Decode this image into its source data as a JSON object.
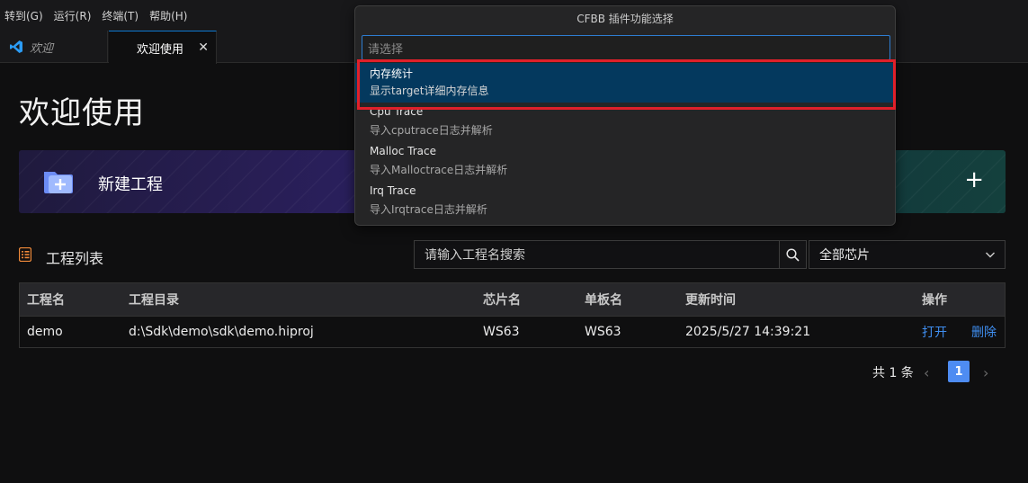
{
  "menubar": {
    "items": [
      "转到(G)",
      "运行(R)",
      "终端(T)",
      "帮助(H)"
    ]
  },
  "tabs": [
    {
      "label": "欢迎",
      "active": false
    },
    {
      "label": "欢迎使用",
      "active": true
    }
  ],
  "main": {
    "title": "欢迎使用",
    "new_project_label": "新建工程",
    "list_title": "工程列表",
    "search_placeholder": "请输入工程名搜索",
    "chip_filter": "全部芯片"
  },
  "table": {
    "headers": [
      "工程名",
      "工程目录",
      "芯片名",
      "单板名",
      "更新时间",
      "操作"
    ],
    "rows": [
      {
        "name": "demo",
        "path": "d:\\Sdk\\demo\\sdk\\demo.hiproj",
        "chip": "WS63",
        "board": "WS63",
        "updated": "2025/5/27 14:39:21",
        "open": "打开",
        "delete": "删除"
      }
    ]
  },
  "pager": {
    "total": "共 1 条",
    "current": "1"
  },
  "quickpick": {
    "title": "CFBB 插件功能选择",
    "placeholder": "请选择",
    "items": [
      {
        "label": "内存统计",
        "detail": "显示target详细内存信息",
        "selected": true
      },
      {
        "label": "Cpu Trace",
        "detail": "导入cputrace日志并解析",
        "selected": false
      },
      {
        "label": "Malloc Trace",
        "detail": "导入Malloctrace日志并解析",
        "selected": false
      },
      {
        "label": "Irq Trace",
        "detail": "导入Irqtrace日志并解析",
        "selected": false
      }
    ]
  },
  "colors": {
    "accent": "#04395e",
    "link": "#3f8ef0",
    "highlight": "#e0202a",
    "pager_active": "#4e8cf2"
  }
}
